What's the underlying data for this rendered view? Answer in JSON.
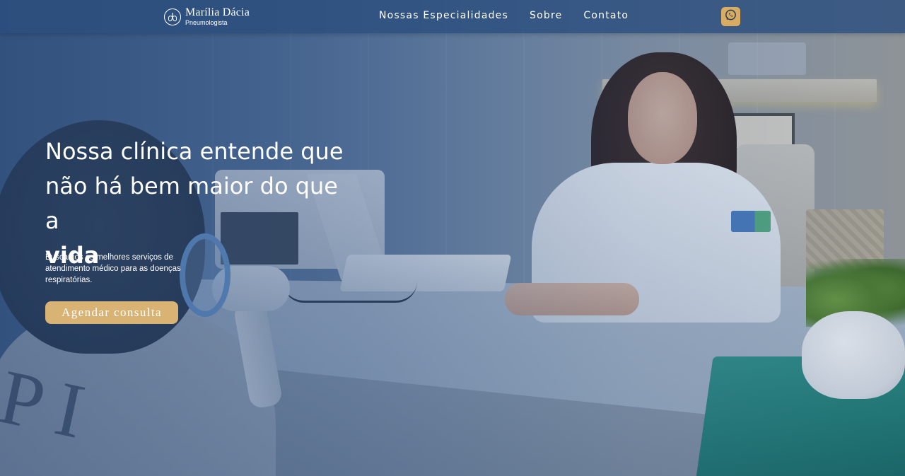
{
  "brand": {
    "name": "Marília Dácia",
    "subtitle": "Pneumologista",
    "logo_icon": "lungs-icon"
  },
  "nav": {
    "items": [
      {
        "label": "Nossas Especialidades"
      },
      {
        "label": "Sobre"
      },
      {
        "label": "Contato"
      }
    ],
    "whatsapp_icon": "whatsapp-icon"
  },
  "hero": {
    "title_line1": "Nossa clínica entende que",
    "title_line2": "não há bem maior do que a",
    "title_strong": "vida",
    "description": "Buscamos os melhores serviços de atendimento médico para as doenças respiratórias.",
    "cta_label": "Agendar consulta"
  },
  "colors": {
    "navbar": "#2b4e7e",
    "accent_gold": "#d8b373",
    "text": "#ffffff"
  }
}
